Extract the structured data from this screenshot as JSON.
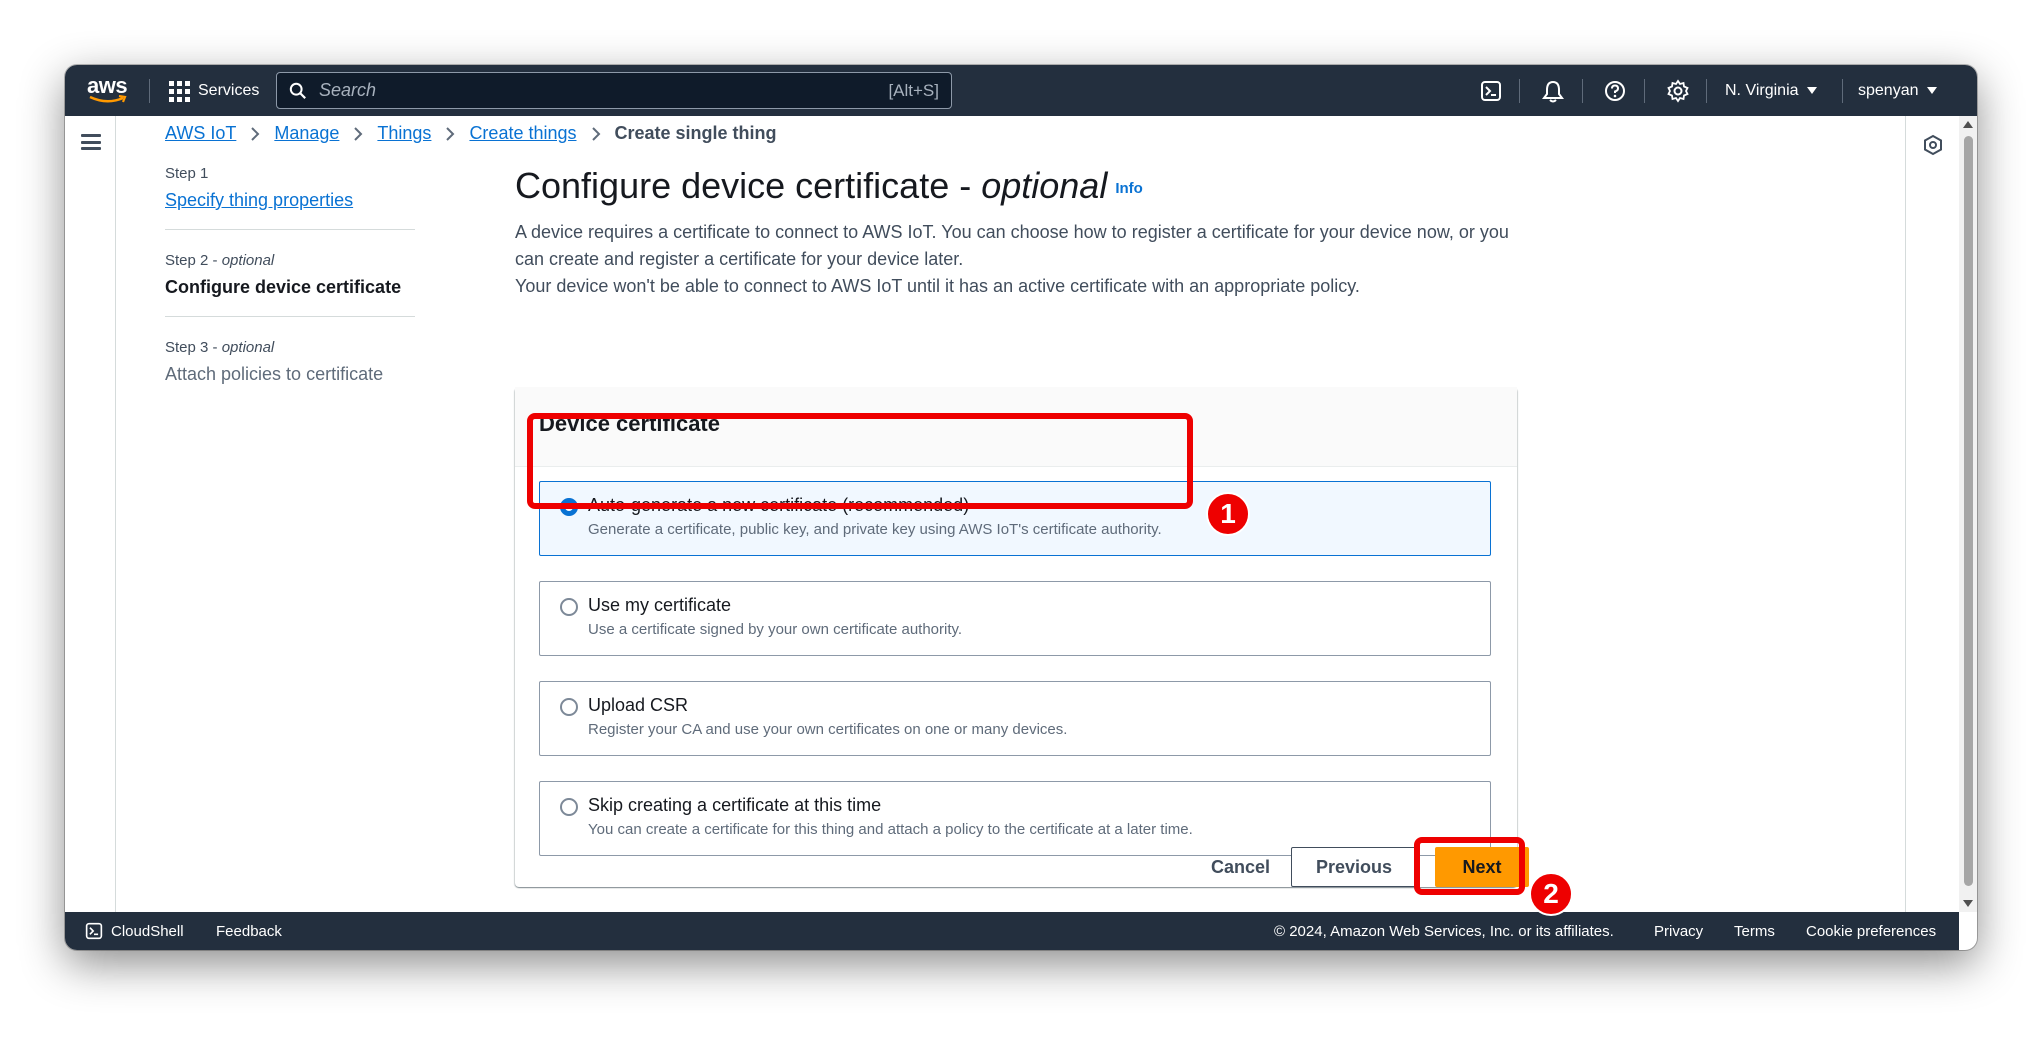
{
  "topnav": {
    "logo_text": "aws",
    "services_label": "Services",
    "search_placeholder": "Search",
    "search_shortcut": "[Alt+S]",
    "region": "N. Virginia",
    "user": "spenyan"
  },
  "breadcrumb": {
    "items": [
      "AWS IoT",
      "Manage",
      "Things",
      "Create things"
    ],
    "current": "Create single thing"
  },
  "steps": [
    {
      "num": "Step 1",
      "qualifier": "",
      "title": "Specify thing properties"
    },
    {
      "num": "Step 2",
      "qualifier": "optional",
      "title": "Configure device certificate"
    },
    {
      "num": "Step 3",
      "qualifier": "optional",
      "title": "Attach policies to certificate"
    }
  ],
  "main": {
    "title": "Configure device certificate",
    "title_sep": " - ",
    "title_qualifier": "optional",
    "info_link": "Info",
    "description_1": "A device requires a certificate to connect to AWS IoT. You can choose how to register a certificate for your device now, or you can create and register a certificate for your device later.",
    "description_2": "Your device won't be able to connect to AWS IoT until it has an active certificate with an appropriate policy."
  },
  "card": {
    "title": "Device certificate",
    "options": [
      {
        "label": "Auto-generate a new certificate (recommended)",
        "description": "Generate a certificate, public key, and private key using AWS IoT's certificate authority.",
        "selected": true
      },
      {
        "label": "Use my certificate",
        "description": "Use a certificate signed by your own certificate authority.",
        "selected": false
      },
      {
        "label": "Upload CSR",
        "description": "Register your CA and use your own certificates on one or many devices.",
        "selected": false
      },
      {
        "label": "Skip creating a certificate at this time",
        "description": "You can create a certificate for this thing and attach a policy to the certificate at a later time.",
        "selected": false
      }
    ]
  },
  "actions": {
    "cancel": "Cancel",
    "previous": "Previous",
    "next": "Next"
  },
  "footer": {
    "cloudshell": "CloudShell",
    "feedback": "Feedback",
    "copyright": "© 2024, Amazon Web Services, Inc. or its affiliates.",
    "privacy": "Privacy",
    "terms": "Terms",
    "cookie": "Cookie preferences"
  },
  "annotations": {
    "badge_1": "1",
    "badge_2": "2"
  },
  "colors": {
    "nav_bg": "#232f3e",
    "link": "#0972d3",
    "primary_button": "#ff9900",
    "highlight": "#ee0000"
  }
}
